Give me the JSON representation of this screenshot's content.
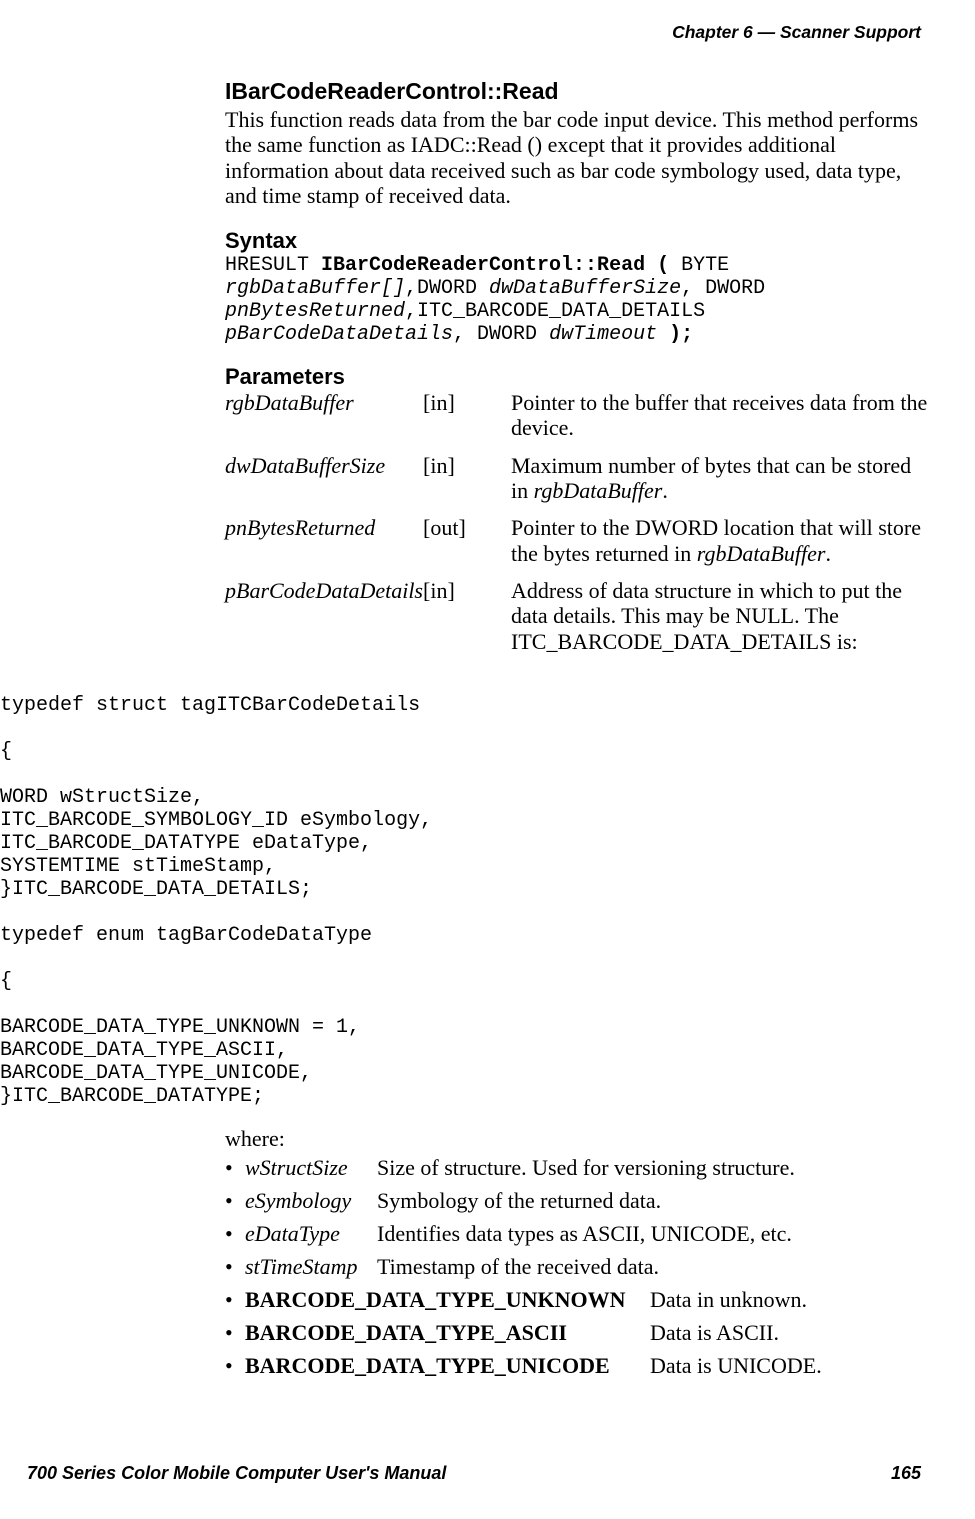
{
  "header": {
    "chapter": "Chapter  6  —  Scanner Support"
  },
  "title": "IBarCodeReaderControl::Read",
  "intro": "This function reads data from the bar code input device. This method performs the same function as IADC::Read () except that it provides additional information about data received such as bar code symbology used, data type, and time stamp of received data.",
  "syntax_heading": "Syntax",
  "syntax": {
    "line1a": "HRESULT ",
    "line1b": "IBarCodeReaderControl::Read (",
    "line1c": " BYTE",
    "line2a": "rgbDataBuffer[]",
    "line2b": ",DWORD ",
    "line2c": "dwDataBufferSize",
    "line2d": ", DWORD",
    "line3a": "pnBytesReturned",
    "line3b": ",ITC_BARCODE_DATA_DETAILS",
    "line4a": "pBarCodeDataDetails",
    "line4b": ", DWORD ",
    "line4c": "dwTimeout",
    "line4d": " );"
  },
  "parameters_heading": "Parameters",
  "params": [
    {
      "name": "rgbDataBuffer",
      "dir": "[in]",
      "desc": "Pointer to the buffer that receives data from the device."
    },
    {
      "name": "dwDataBufferSize",
      "dir": "[in]",
      "desc_a": "Maximum number of bytes that can be stored in ",
      "desc_b": "rgbDataBuffer",
      "desc_c": "."
    },
    {
      "name": "pnBytesReturned",
      "dir": "[out]",
      "desc_a": "Pointer to the DWORD location that will store the bytes returned in ",
      "desc_b": "rgbDataBuffer",
      "desc_c": "."
    },
    {
      "name": "pBarCodeDataDetails",
      "dir": "[in]",
      "desc": "Address of data structure in which to put the data details. This may be NULL. The ITC_BARCODE_DATA_DETAILS is:"
    }
  ],
  "code_block": "typedef struct tagITCBarCodeDetails\n\n{\n\nWORD wStructSize,\nITC_BARCODE_SYMBOLOGY_ID eSymbology,\nITC_BARCODE_DATATYPE eDataType,\nSYSTEMTIME stTimeStamp,\n}ITC_BARCODE_DATA_DETAILS;\n\ntypedef enum tagBarCodeDataType\n\n{\n\nBARCODE_DATA_TYPE_UNKNOWN = 1,\nBARCODE_DATA_TYPE_ASCII,\nBARCODE_DATA_TYPE_UNICODE,\n}ITC_BARCODE_DATATYPE;",
  "where_heading": "where:",
  "defs": [
    {
      "term": "wStructSize",
      "desc": "Size of structure. Used for versioning structure."
    },
    {
      "term": "eSymbology",
      "desc": "Symbology of the returned data."
    },
    {
      "term": "eDataType",
      "desc": "Identifies data types as ASCII, UNICODE, etc."
    },
    {
      "term": "stTimeStamp",
      "desc": "Timestamp of the received data."
    }
  ],
  "enums": [
    {
      "term": "BARCODE_DATA_TYPE_UNKNOWN",
      "desc": "Data in unknown."
    },
    {
      "term": "BARCODE_DATA_TYPE_ASCII",
      "desc": "Data is ASCII."
    },
    {
      "term": "BARCODE_DATA_TYPE_UNICODE",
      "desc": "Data is UNICODE."
    }
  ],
  "footer": {
    "left": "700 Series Color Mobile Computer User's Manual",
    "right": "165"
  }
}
